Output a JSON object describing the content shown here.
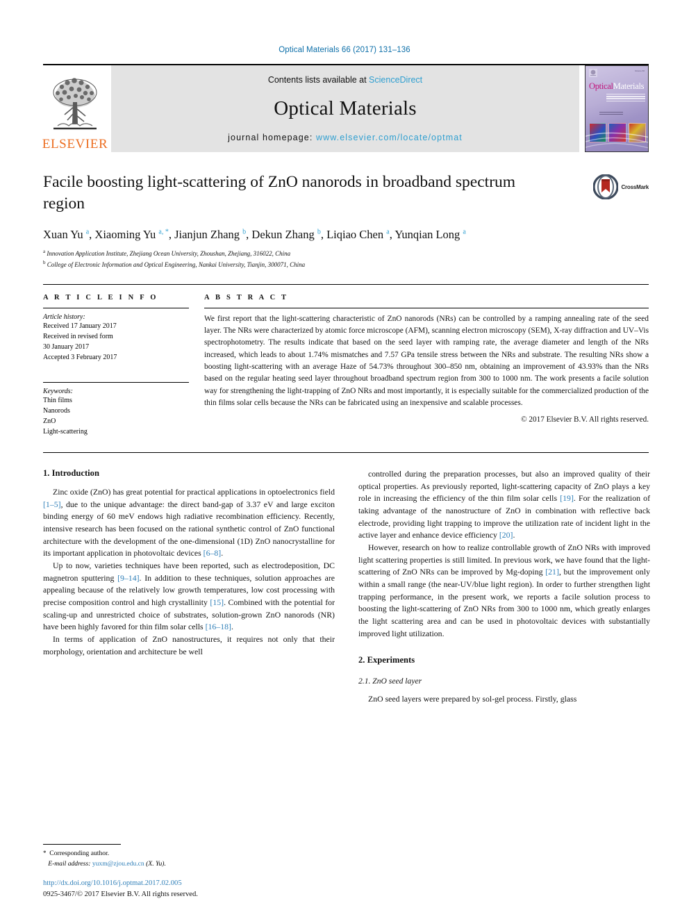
{
  "running_head": "Optical Materials 66 (2017) 131–136",
  "masthead": {
    "publisher": "ELSEVIER",
    "contents_prefix": "Contents lists available at ",
    "contents_link": "ScienceDirect",
    "journal_name": "Optical Materials",
    "homepage_prefix": "journal homepage: ",
    "homepage_url": "www.elsevier.com/locate/optmat",
    "cover": {
      "title_part1": "Optical",
      "title_part2": "Materials"
    }
  },
  "article": {
    "title": "Facile boosting light-scattering of ZnO nanorods in broadband spectrum region",
    "crossmark_label": "CrossMark",
    "authors": [
      {
        "name": "Xuan Yu",
        "marks": "a"
      },
      {
        "name": "Xiaoming Yu",
        "marks": "a, *"
      },
      {
        "name": "Jianjun Zhang",
        "marks": "b"
      },
      {
        "name": "Dekun Zhang",
        "marks": "b"
      },
      {
        "name": "Liqiao Chen",
        "marks": "a"
      },
      {
        "name": "Yunqian Long",
        "marks": "a"
      }
    ],
    "affiliations": [
      {
        "mark": "a",
        "text": "Innovation Application Institute, Zhejiang Ocean University, Zhoushan, Zhejiang, 316022, China"
      },
      {
        "mark": "b",
        "text": "College of Electronic Information and Optical Engineering, Nankai University, Tianjin, 300071, China"
      }
    ]
  },
  "article_info": {
    "heading": "A R T I C L E   I N F O",
    "history_title": "Article history:",
    "history_lines": [
      "Received 17 January 2017",
      "Received in revised form",
      "30 January 2017",
      "Accepted 3 February 2017"
    ],
    "keywords_title": "Keywords:",
    "keywords": [
      "Thin films",
      "Nanorods",
      "ZnO",
      "Light-scattering"
    ]
  },
  "abstract": {
    "heading": "A B S T R A C T",
    "text": "We first report that the light-scattering characteristic of ZnO nanorods (NRs) can be controlled by a ramping annealing rate of the seed layer. The NRs were characterized by atomic force microscope (AFM), scanning electron microscopy (SEM), X-ray diffraction and UV–Vis spectrophotometry. The results indicate that based on the seed layer with ramping rate, the average diameter and length of the NRs increased, which leads to about 1.74% mismatches and 7.57 GPa tensile stress between the NRs and substrate. The resulting NRs show a boosting light-scattering with an average Haze of 54.73% throughout 300–850 nm, obtaining an improvement of 43.93% than the NRs based on the regular heating seed layer throughout broadband spectrum region from 300 to 1000 nm. The work presents a facile solution way for strengthening the light-trapping of ZnO NRs and most importantly, it is especially suitable for the commercialized production of the thin films solar cells because the NRs can be fabricated using an inexpensive and scalable processes.",
    "copyright": "© 2017 Elsevier B.V. All rights reserved."
  },
  "body": {
    "left_column": {
      "section_heading": "1.  Introduction",
      "paragraphs": [
        "Zinc oxide (ZnO) has great potential for practical applications in optoelectronics field [1–5], due to the unique advantage: the direct band-gap of 3.37 eV and large exciton binding energy of 60 meV endows high radiative recombination efficiency. Recently, intensive research has been focused on the rational synthetic control of ZnO functional architecture with the development of the one-dimensional (1D) ZnO nanocrystalline for its important application in photovoltaic devices [6–8].",
        "Up to now, varieties techniques have been reported, such as electrodeposition, DC magnetron sputtering [9–14]. In addition to these techniques, solution approaches are appealing because of the relatively low growth temperatures, low cost processing with precise composition control and high crystallinity [15]. Combined with the potential for scaling-up and unrestricted choice of substrates, solution-grown ZnO nanorods (NR) have been highly favored for thin film solar cells [16–18].",
        "In terms of application of ZnO nanostructures, it requires not only that their morphology, orientation and architecture be well"
      ]
    },
    "right_column": {
      "paragraphs": [
        "controlled during the preparation processes, but also an improved quality of their optical properties. As previously reported, light-scattering capacity of ZnO plays a key role in increasing the efficiency of the thin film solar cells [19]. For the realization of taking advantage of the nanostructure of ZnO in combination with reflective back electrode, providing light trapping to improve the utilization rate of incident light in the active layer and enhance device efficiency [20].",
        "However, research on how to realize controllable growth of ZnO NRs with improved light scattering properties is still limited. In previous work, we have found that the light-scattering of ZnO NRs can be improved by Mg-doping [21], but the improvement only within a small range (the near-UV/blue light region). In order to further strengthen light trapping performance, in the present work, we reports a facile solution process to boosting the light-scattering of ZnO NRs from 300 to 1000 nm, which greatly enlarges the light scattering area and can be used in photovoltaic devices with substantially improved light utilization."
      ],
      "section_heading": "2.  Experiments",
      "subsection_heading": "2.1.  ZnO seed layer",
      "subsection_paragraph": "ZnO seed layers were prepared by sol-gel process. Firstly, glass"
    }
  },
  "footnote": {
    "corresponding": "Corresponding author.",
    "email_label": "E-mail address:",
    "email": "yuxm@zjou.edu.cn",
    "email_suffix": "(X. Yu)."
  },
  "footer": {
    "doi": "http://dx.doi.org/10.1016/j.optmat.2017.02.005",
    "issn": "0925-3467/© 2017 Elsevier B.V. All rights reserved."
  }
}
